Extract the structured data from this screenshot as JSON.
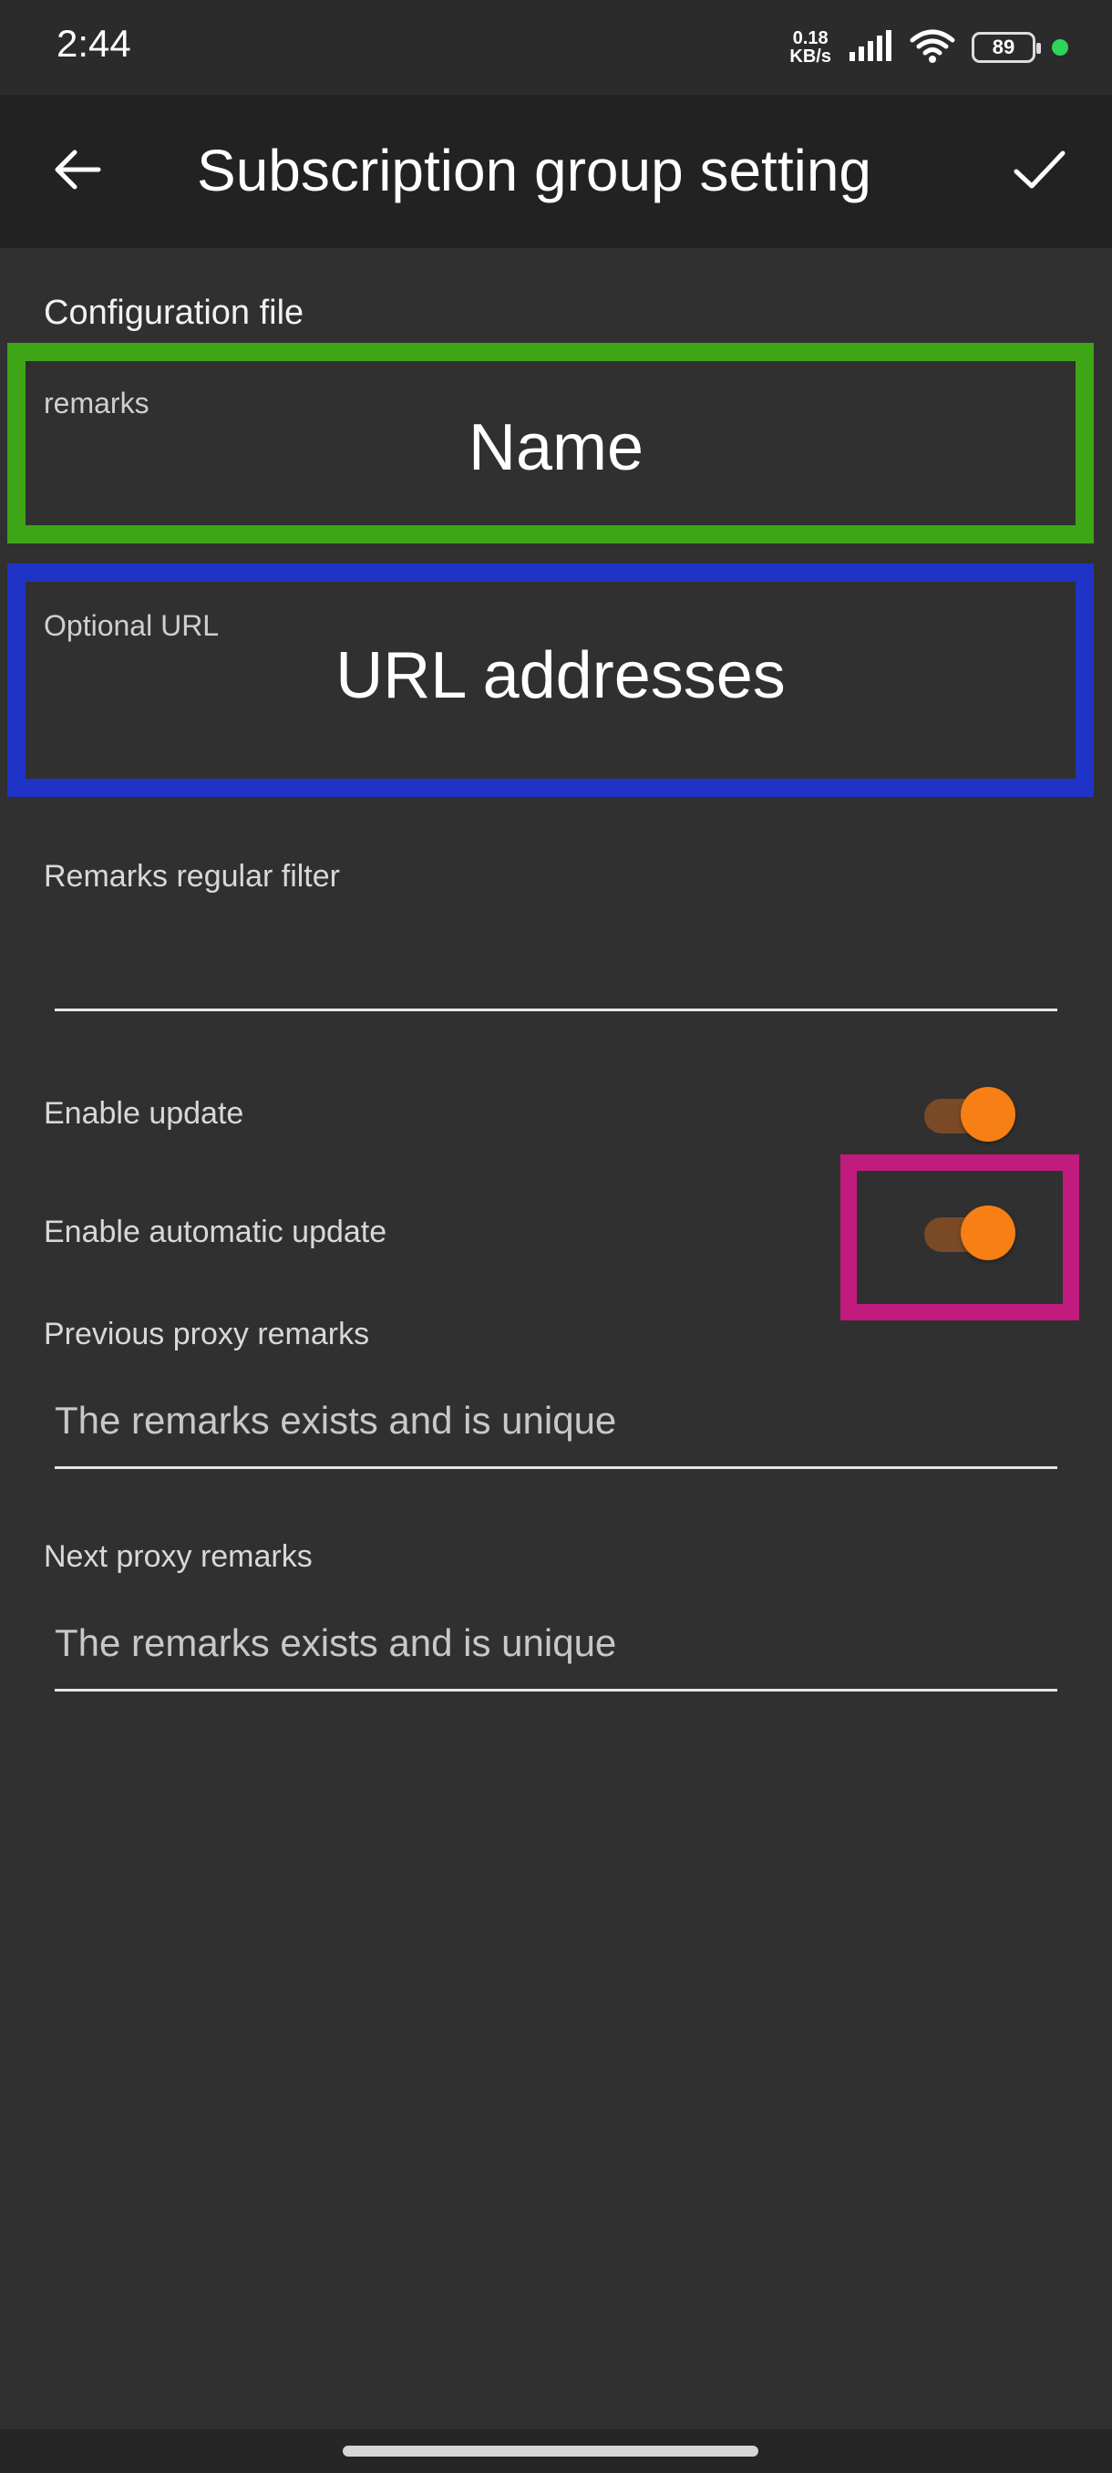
{
  "status_bar": {
    "time": "2:44",
    "net_speed_value": "0.18",
    "net_speed_unit": "KB/s",
    "battery_level": "89"
  },
  "app_bar": {
    "title": "Subscription group setting",
    "back_icon": "arrow-back-icon",
    "confirm_icon": "check-icon"
  },
  "form": {
    "section_title": "Configuration file",
    "remarks_label": "remarks",
    "remarks_overlay": "Name",
    "url_label": "Optional URL",
    "url_overlay": "URL addresses",
    "filter_label": "Remarks regular filter",
    "filter_value": "",
    "enable_update_label": "Enable update",
    "enable_update_on": true,
    "auto_update_label": "Enable automatic update",
    "auto_update_on": true,
    "prev_proxy_label": "Previous proxy remarks",
    "prev_proxy_placeholder": "The remarks exists and is unique",
    "next_proxy_label": "Next proxy remarks",
    "next_proxy_placeholder": "The remarks exists and is unique"
  },
  "colors": {
    "accent": "#f77f13",
    "highlight_green": "#3ea616",
    "highlight_blue": "#1f33c6",
    "highlight_magenta": "#c11b7d"
  }
}
